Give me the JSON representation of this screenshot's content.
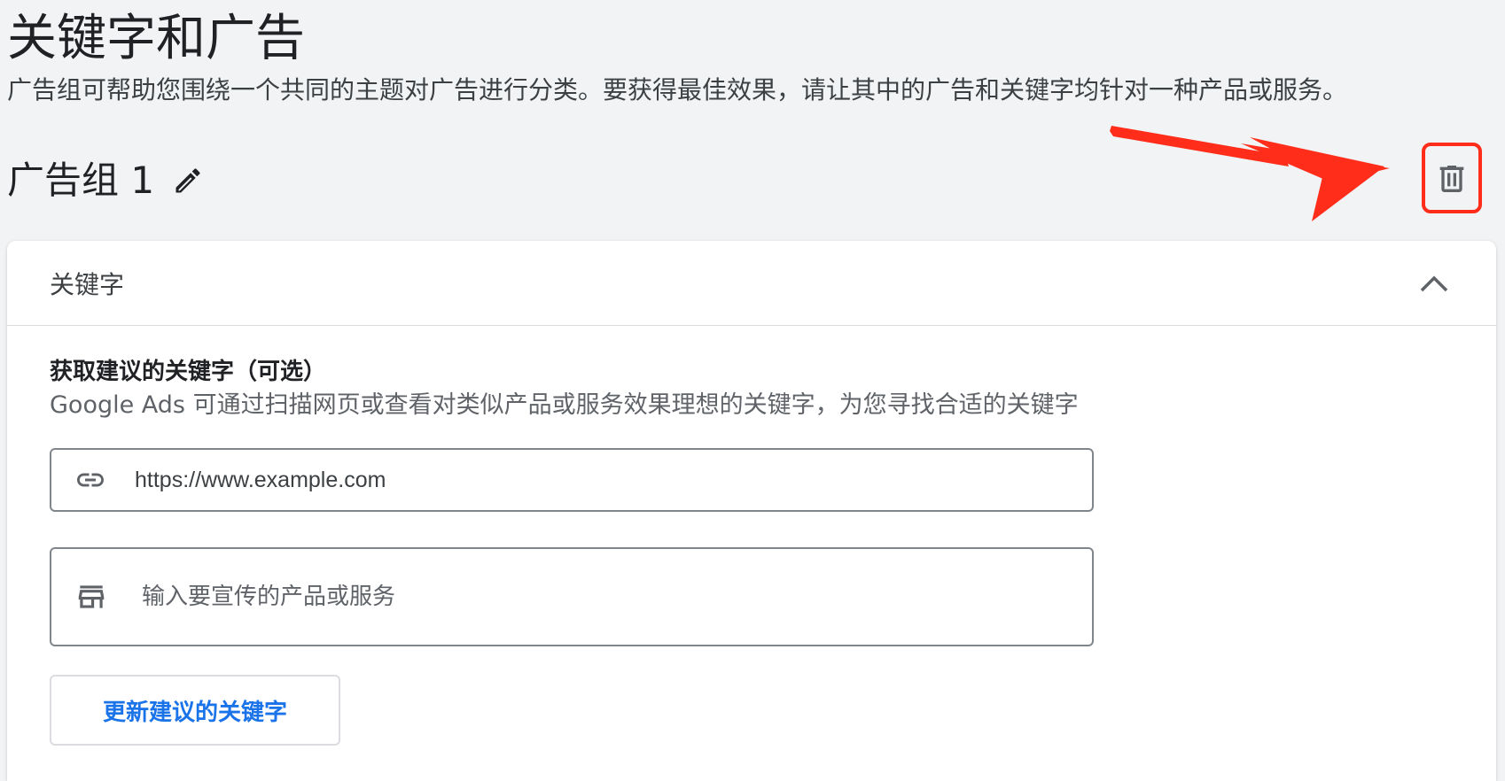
{
  "page": {
    "title": "关键字和广告",
    "description": "广告组可帮助您围绕一个共同的主题对广告进行分类。要获得最佳效果，请让其中的广告和关键字均针对一种产品或服务。"
  },
  "ad_group": {
    "name": "广告组 1",
    "edit_icon": "pencil-icon",
    "delete_icon": "trash-icon"
  },
  "annotation": {
    "color": "#ff2d1a"
  },
  "keywords_card": {
    "header_title": "关键字",
    "collapse_icon": "chevron-up-icon",
    "section_title": "获取建议的关键字（可选）",
    "section_description": "Google Ads 可通过扫描网页或查看对类似产品或服务效果理想的关键字，为您寻找合适的关键字",
    "url_input": {
      "icon": "link-icon",
      "value": "https://www.example.com"
    },
    "product_input": {
      "icon": "store-icon",
      "placeholder": "输入要宣传的产品或服务"
    },
    "update_button_label": "更新建议的关键字"
  },
  "colors": {
    "background": "#f1f3f4",
    "accent": "#1a73e8"
  }
}
